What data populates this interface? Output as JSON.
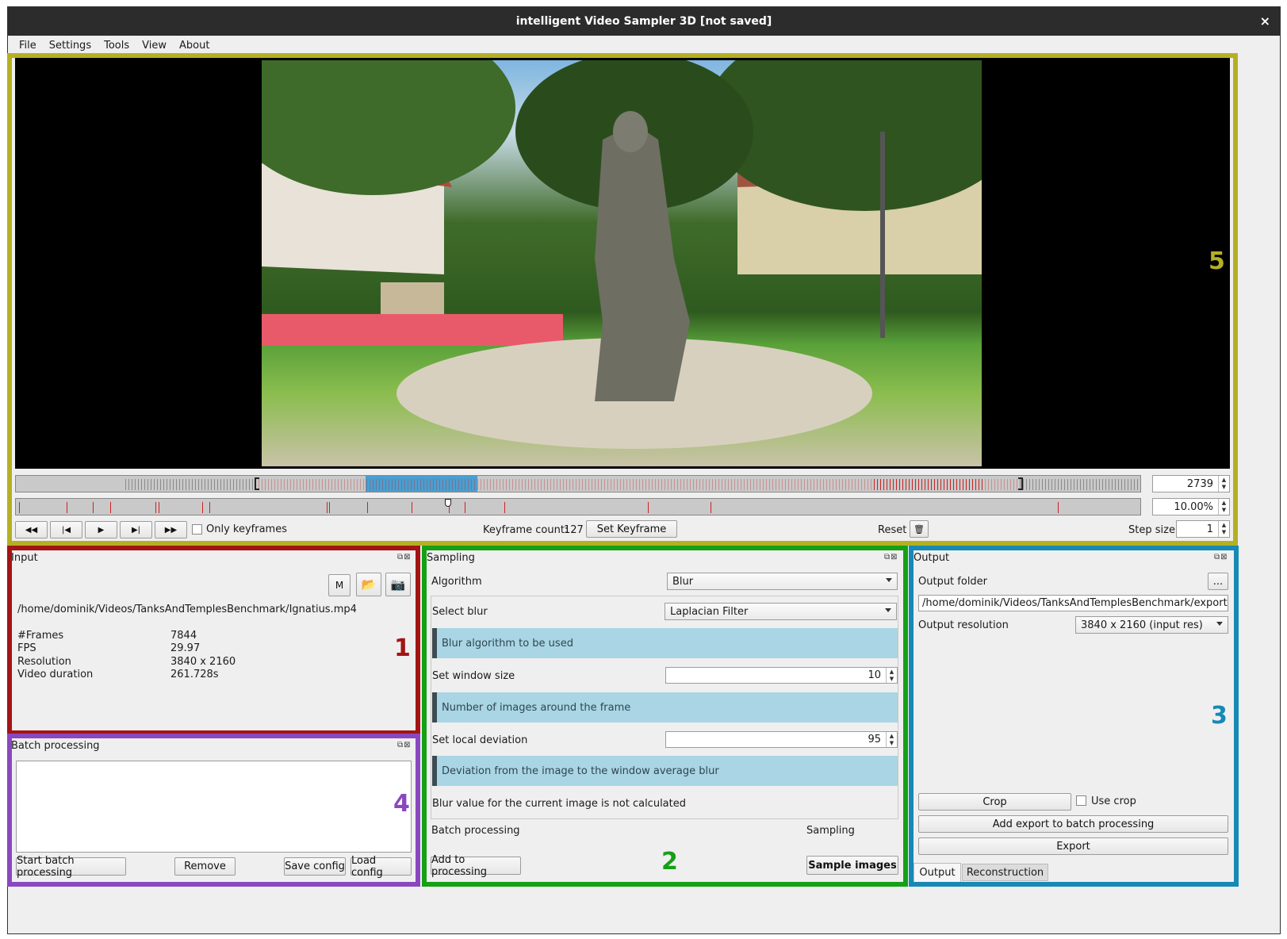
{
  "window": {
    "title": "intelligent Video Sampler 3D [not saved]",
    "close": "×"
  },
  "menu": [
    "File",
    "Settings",
    "Tools",
    "View",
    "About"
  ],
  "colors": {
    "panel5": "#b5b021",
    "panel1": "#a31414",
    "panel2": "#15a015",
    "panel3": "#1789b5",
    "panel4": "#8a48c0",
    "selection": "#4a9fd0",
    "keyframe_tick": "#cc2222",
    "info_bg": "#a9d5e4"
  },
  "player": {
    "frame_value": "2739",
    "zoom_value": "10.00%",
    "only_keyframes_label": "Only keyframes",
    "keyframe_count_label": "Keyframe count:",
    "keyframe_count": "127",
    "set_keyframe_label": "Set Keyframe",
    "reset_label": "Reset",
    "step_size_label": "Step size",
    "step_size_value": "1",
    "controls": [
      "rewind-icon",
      "skip-back-icon",
      "play-icon",
      "skip-forward-icon",
      "fast-forward-icon"
    ],
    "panel_number": "5"
  },
  "input": {
    "title": "Input",
    "m_label": "M",
    "path": "/home/dominik/Videos/TanksAndTemplesBenchmark/Ignatius.mp4",
    "props": [
      {
        "key": "#Frames",
        "value": "7844"
      },
      {
        "key": "FPS",
        "value": "29.97"
      },
      {
        "key": "Resolution",
        "value": "3840 x 2160"
      },
      {
        "key": "Video duration",
        "value": "261.728s"
      }
    ],
    "panel_number": "1"
  },
  "batch": {
    "title": "Batch processing",
    "start_label": "Start batch processing",
    "remove_label": "Remove",
    "save_label": "Save config",
    "load_label": "Load config",
    "panel_number": "4"
  },
  "sampling": {
    "title": "Sampling",
    "algorithm_label": "Algorithm",
    "algorithm_value": "Blur",
    "select_blur_label": "Select blur",
    "select_blur_value": "Laplacian Filter",
    "info_blur": "Blur algorithm to be used",
    "window_size_label": "Set window size",
    "window_size_value": "10",
    "info_window": "Number of images around the frame",
    "local_dev_label": "Set local deviation",
    "local_dev_value": "95",
    "info_dev": "Deviation from the image to the window average blur",
    "blur_status": "Blur value for the current image is not calculated",
    "batch_label": "Batch processing",
    "sampling_label": "Sampling",
    "add_label": "Add to processing",
    "sample_label": "Sample images",
    "panel_number": "2"
  },
  "output": {
    "title": "Output",
    "folder_label": "Output folder",
    "browse_label": "...",
    "folder_value": "/home/dominik/Videos/TanksAndTemplesBenchmark/export",
    "resolution_label": "Output resolution",
    "resolution_value": "3840 x 2160 (input res)",
    "crop_label": "Crop",
    "use_crop_label": "Use crop",
    "add_export_label": "Add export to batch processing",
    "export_label": "Export",
    "tabs": [
      "Output",
      "Reconstruction"
    ],
    "panel_number": "3"
  }
}
